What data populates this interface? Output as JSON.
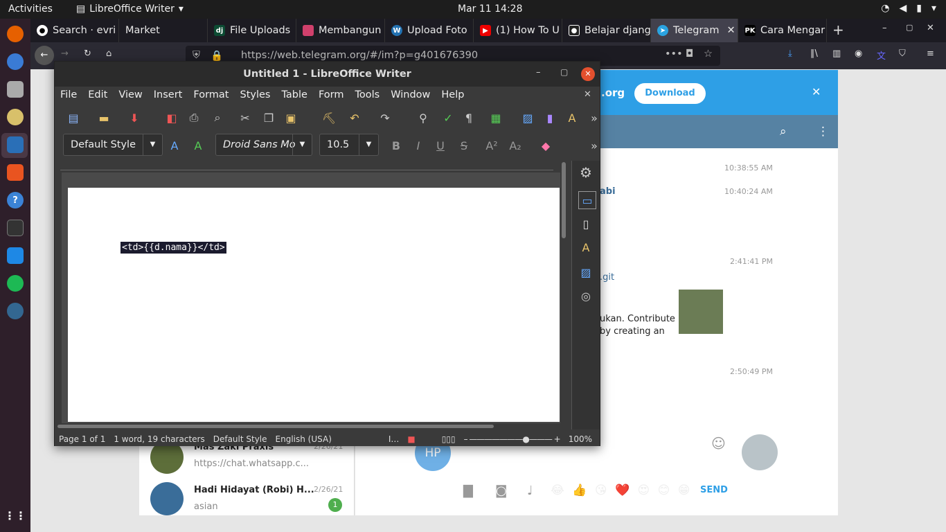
{
  "topbar": {
    "activities": "Activities",
    "app": "LibreOffice Writer",
    "clock": "Mar 11  14:28"
  },
  "tabs": [
    {
      "label": "Search · evri",
      "color": "#333"
    },
    {
      "label": "Market",
      "color": "#444"
    },
    {
      "label": "File Uploads",
      "color": "#0c4b33"
    },
    {
      "label": "Membangun",
      "color": "#d0406c"
    },
    {
      "label": "Upload Foto",
      "color": "#2271b1"
    },
    {
      "label": "(1) How To U",
      "color": "#e00"
    },
    {
      "label": "Belajar djang",
      "color": "#222"
    },
    {
      "label": "Telegram",
      "color": "#2aa3e0"
    },
    {
      "label": "Cara Mengar",
      "color": "#222"
    }
  ],
  "url": "https://web.telegram.org/#/im?p=g401676390",
  "telegram": {
    "banner_text": ".org",
    "download": "Download",
    "times": [
      "10:38:55 AM",
      "10:40:24 AM",
      "2:41:41 PM",
      "2:50:49 PM"
    ],
    "name_frag": "abi",
    "git_frag": ".git",
    "msg1": "ukan. Contribute",
    "msg2": "by creating an",
    "chat1_name": "Mas Zaki Praxis",
    "chat1_date": "2/26/21",
    "chat1_msg": "https://chat.whatsapp.c...",
    "chat2_name": "Hadi Hidayat (Robi) H...",
    "chat2_date": "2/26/21",
    "chat2_msg": "asian",
    "chat2_badge": "1",
    "avatar": "HP",
    "send": "SEND",
    "emojis": "😂 👍 😘 ❤️ 😍 😊 😁"
  },
  "writer": {
    "title": "Untitled 1 - LibreOffice Writer",
    "menu": [
      "File",
      "Edit",
      "View",
      "Insert",
      "Format",
      "Styles",
      "Table",
      "Form",
      "Tools",
      "Window",
      "Help"
    ],
    "para_style": "Default Style",
    "font_name": "Droid Sans Mo",
    "font_size": "10.5",
    "doc_text": "<td>{{d.nama}}</td>",
    "status": {
      "page": "Page 1 of 1",
      "words": "1 word, 19 characters",
      "style": "Default Style",
      "lang": "English (USA)",
      "zoom": "100%"
    }
  }
}
